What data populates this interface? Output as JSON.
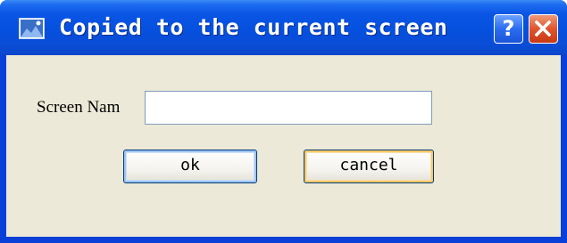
{
  "dialog": {
    "title": "Copied to the current screen",
    "help_label": "?",
    "form": {
      "screen_name_label": "Screen Nam",
      "screen_name_value": "",
      "ok_label": "ok",
      "cancel_label": "cancel"
    }
  },
  "icons": {
    "title": "window-icon",
    "help": "help-icon",
    "close": "close-icon"
  },
  "colors": {
    "titlebar": "#0550de",
    "client_bg": "#ece9d8",
    "close_button": "#e0542c",
    "help_button": "#2a6cf0"
  }
}
